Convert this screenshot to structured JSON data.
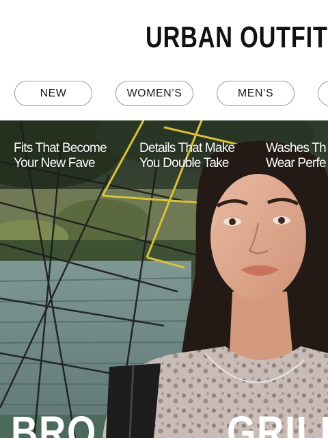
{
  "header": {
    "logo_text": "URBAN OUTFITTI"
  },
  "nav": {
    "items": [
      {
        "label": "NEW"
      },
      {
        "label": "WOMEN’S"
      },
      {
        "label": "MEN’S"
      },
      {
        "label": ""
      }
    ]
  },
  "hero": {
    "captions": [
      {
        "line1": "Fits That Become",
        "line2": "Your New Fave"
      },
      {
        "line1": "Details That Make",
        "line2": "You Double Take"
      },
      {
        "line1": "Washes Th",
        "line2": "Wear Perfe"
      }
    ],
    "big_words": [
      "BRO",
      "GRILL"
    ]
  },
  "colors": {
    "nav_border": "#9a9a9a",
    "net_yellow": "#d9c23a",
    "caption_text": "#ffffff"
  }
}
